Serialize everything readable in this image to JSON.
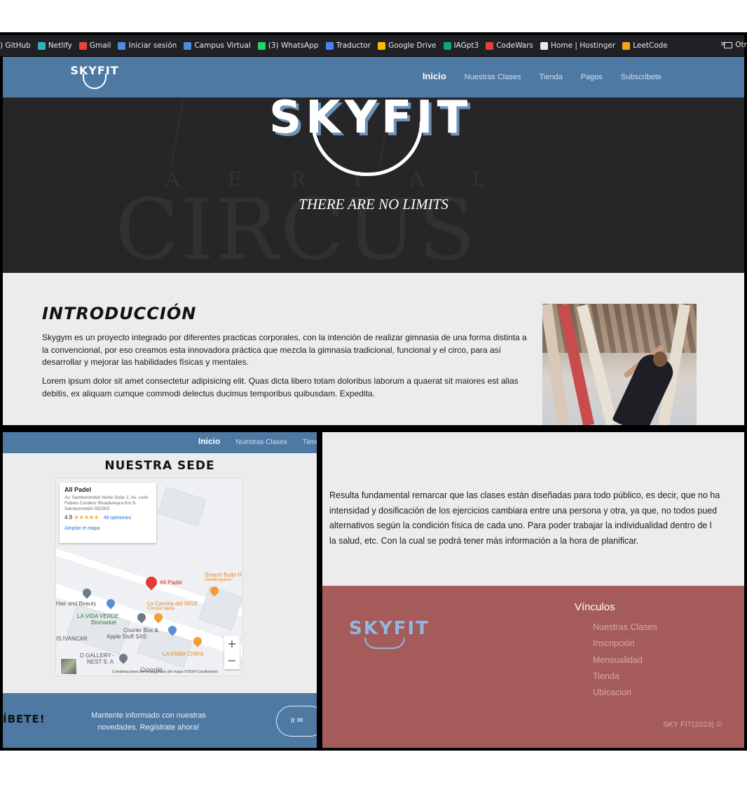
{
  "bookmarks": [
    {
      "label": ") GitHub",
      "icon": "github-icon",
      "color": "#e8eaed"
    },
    {
      "label": "Netlify",
      "icon": "netlify-icon",
      "color": "#2fb3b8"
    },
    {
      "label": "Gmail",
      "icon": "gmail-icon",
      "color": "#ea4335"
    },
    {
      "label": "Iniciar sesión",
      "icon": "uc-icon",
      "color": "#4a90d9"
    },
    {
      "label": "Campus Virtual",
      "icon": "uc-icon",
      "color": "#4a90d9"
    },
    {
      "label": "(3) WhatsApp",
      "icon": "whatsapp-icon",
      "color": "#25d366"
    },
    {
      "label": "Traductor",
      "icon": "translate-icon",
      "color": "#4285f4"
    },
    {
      "label": "Google Drive",
      "icon": "drive-icon",
      "color": "#fbbc04"
    },
    {
      "label": "IAGpt3",
      "icon": "ai-icon",
      "color": "#10a37f"
    },
    {
      "label": "CodeWars",
      "icon": "codewars-icon",
      "color": "#e0443a"
    },
    {
      "label": "Home | Hostinger",
      "icon": "globe-icon",
      "color": "#e8eaed"
    },
    {
      "label": "LeetCode",
      "icon": "leetcode-icon",
      "color": "#ffa116"
    }
  ],
  "bookmarks_more": "»",
  "bookmarks_other": "Otr",
  "nav": {
    "logo": "SKYFIT",
    "links": [
      "Inicio",
      "Nuestras Clases",
      "Tienda",
      "Pagos",
      "Subscribete"
    ]
  },
  "hero": {
    "logo": "SKYFIT",
    "bg_word_1": "A E R I A L",
    "bg_word_2": "CIRCUS",
    "tagline": "THERE ARE NO LIMITS"
  },
  "intro": {
    "title": "INTRODUCCIÓN",
    "p1": "Skygym es un proyecto integrado por diferentes practicas corporales, con la intención de realizar gimnasia de una forma distinta a la convencional, por eso creamos esta innovadora práctica que mezcla la gimnasia tradicional, funcional y el circo, para así desarrollar y mejorar las habilidades físicas y mentales.",
    "p2": "Lorem ipsum dolor sit amet consectetur adipisicing elit. Quas dicta libero totam doloribus laborum a quaerat sit maiores est alias debitis, ex aliquam cumque commodi delectus ducimus temporibus quibusdam. Expedita."
  },
  "sede": {
    "nav_links": [
      "Inicio",
      "Nuestras Clases",
      "Tiend"
    ],
    "title": "NUESTRA SEDE",
    "map": {
      "place_name": "All Padel",
      "address": "Av. Samborondón Norte Solar 2, Av. León Febres Cordero Rivadeneyra Km 9, Samborondón 092302",
      "rating": "4.9",
      "stars": "★★★★★",
      "reviews": "48 opiniones",
      "enlarge": "Ampliar el mapa",
      "pois": {
        "all_padel": "All Padel",
        "smash": "Smash Buijo H",
        "smash_sub": "Hamburguesa",
        "carreta": "La Carreta del INGE",
        "carreta_sub": "Comida rápida",
        "hair": "Hair and Beauty",
        "vida_verde": "LA VIDA VERDE",
        "vida_verde_2": "Biomarket",
        "courier": "Courier Box &",
        "courier_2": "Apple Stuff SAS",
        "ivancar": "IS IVANCAR",
        "dgallery": "D GALLERY -",
        "dgallery_2": "NEST S. A",
        "fama": "LA FAMA CHIFA"
      },
      "zoom_in": "+",
      "zoom_out": "−",
      "google": "Google",
      "footer": "Combinaciones de teclas   Datos del mapa ©2024   Condiciones"
    }
  },
  "subscribe": {
    "title": "ÍBETE!",
    "text": "Mantente informado con nuestras novedades. Regístrate ahora!",
    "button": "Ir ✉"
  },
  "classes": {
    "lines": [
      "Resulta fundamental remarcar que las clases están diseñadas para todo público, es decir, que no ha",
      "intensidad y dosificación de los ejercicios cambiara entre una persona y otra, ya que, no todos pued",
      "alternativos según la condición física de cada uno. Para poder trabajar la individualidad dentro de l",
      "la salud, etc. Con la cual se podrá tener más información a la hora de planificar."
    ]
  },
  "footer": {
    "logo": "SKYFIT",
    "links_title": "Vínculos",
    "links": [
      "Nuestras Clases",
      "Inscripción",
      "Mensualidad",
      "Tienda",
      "Ubicacion"
    ],
    "copyright": "SKY FIT(2023) ©"
  },
  "colors": {
    "nav": "#4e79a3",
    "hero": "#262527",
    "footer": "#a55b5a",
    "footer_link": "#d7a8a6",
    "logo_accent": "#8fb8e3"
  }
}
